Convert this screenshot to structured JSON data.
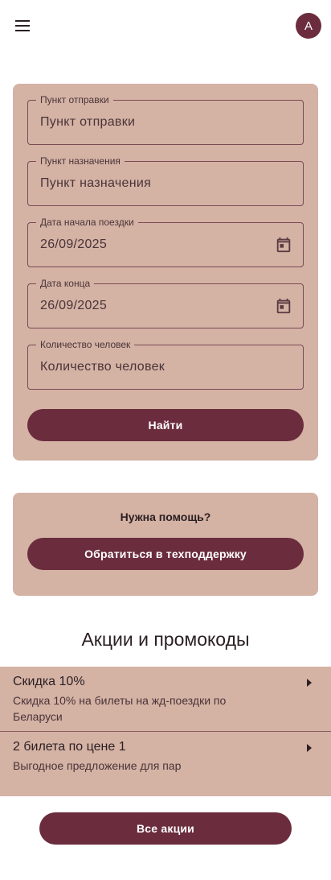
{
  "header": {
    "menu_icon": "hamburger-menu-icon",
    "avatar_letter": "A"
  },
  "search": {
    "fields": [
      {
        "label": "Пункт отправки",
        "value": "Пункт отправки",
        "has_calendar": false
      },
      {
        "label": "Пункт назначения",
        "value": "Пункт назначения",
        "has_calendar": false
      },
      {
        "label": "Дата начала поездки",
        "value": "26/09/2025",
        "has_calendar": true
      },
      {
        "label": "Дата конца",
        "value": "26/09/2025",
        "has_calendar": true
      },
      {
        "label": "Количество человек",
        "value": "Количество человек",
        "has_calendar": false
      }
    ],
    "find_label": "Найти"
  },
  "help": {
    "title": "Нужна помощь?",
    "support_label": "Обратиться в техподдержку"
  },
  "promos": {
    "title": "Акции и промокоды",
    "items": [
      {
        "title": "Скидка 10%",
        "description": "Скидка 10% на билеты на жд-поездки по Беларуси"
      },
      {
        "title": "2 билета по цене 1",
        "description": "Выгодное предложение для пар"
      }
    ],
    "all_label": "Все акции"
  },
  "colors": {
    "primary": "#6b2d3e",
    "card_background": "#d4b2a4",
    "outline": "#7a4a55"
  }
}
